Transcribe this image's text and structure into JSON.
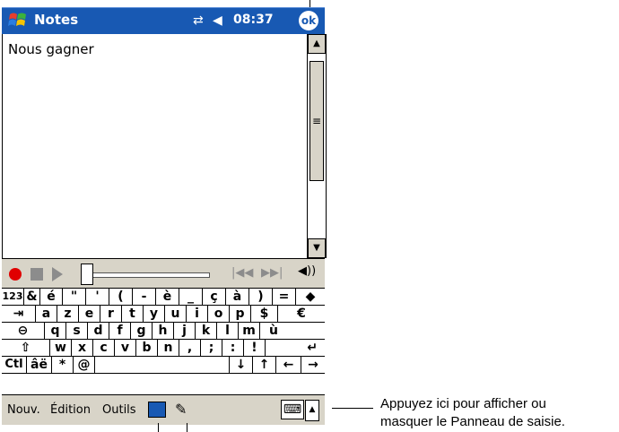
{
  "titlebar": {
    "app_title": "Notes",
    "clock": "08:37",
    "ok_label": "ok",
    "start_icon": "windows-flag-icon",
    "connection_icon": "connectivity-icon",
    "volume_icon": "speaker-volume-icon"
  },
  "document": {
    "text": "Nous gagner"
  },
  "recording_toolbar": {
    "record_icon": "record-icon",
    "stop_icon": "stop-icon",
    "play_icon": "play-icon",
    "prev_icon": "skip-back-icon",
    "next_icon": "skip-forward-icon",
    "speaker_icon": "speaker-icon"
  },
  "keyboard": {
    "rows": [
      [
        "123",
        "&",
        "é",
        "\"",
        "'",
        "(",
        "-",
        "è",
        "_",
        "ç",
        "à",
        ")",
        "=",
        "◆"
      ],
      [
        "⇥",
        "a",
        "z",
        "e",
        "r",
        "t",
        "y",
        "u",
        "i",
        "o",
        "p",
        "$",
        "€"
      ],
      [
        "⊖",
        "q",
        "s",
        "d",
        "f",
        "g",
        "h",
        "j",
        "k",
        "l",
        "m",
        "ù"
      ],
      [
        "⇧",
        "w",
        "x",
        "c",
        "v",
        "b",
        "n",
        ",",
        ";",
        ":",
        "!",
        "↵"
      ],
      [
        "Ctl",
        "âë",
        "*",
        "@",
        "",
        "↓",
        "↑",
        "←",
        "→"
      ]
    ]
  },
  "menubar": {
    "items": [
      "Nouv.",
      "Édition",
      "Outils"
    ],
    "input_panel_icon": "input-panel-icon",
    "pen_icon": "pen-icon",
    "sip_icon": "keyboard-icon"
  },
  "callout": {
    "line1": "Appuyez ici pour afficher ou",
    "line2": "masquer le Panneau de saisie."
  },
  "colors": {
    "titlebar": "#1859b3",
    "toolbar": "#d8d4c8",
    "record": "#e00000"
  }
}
